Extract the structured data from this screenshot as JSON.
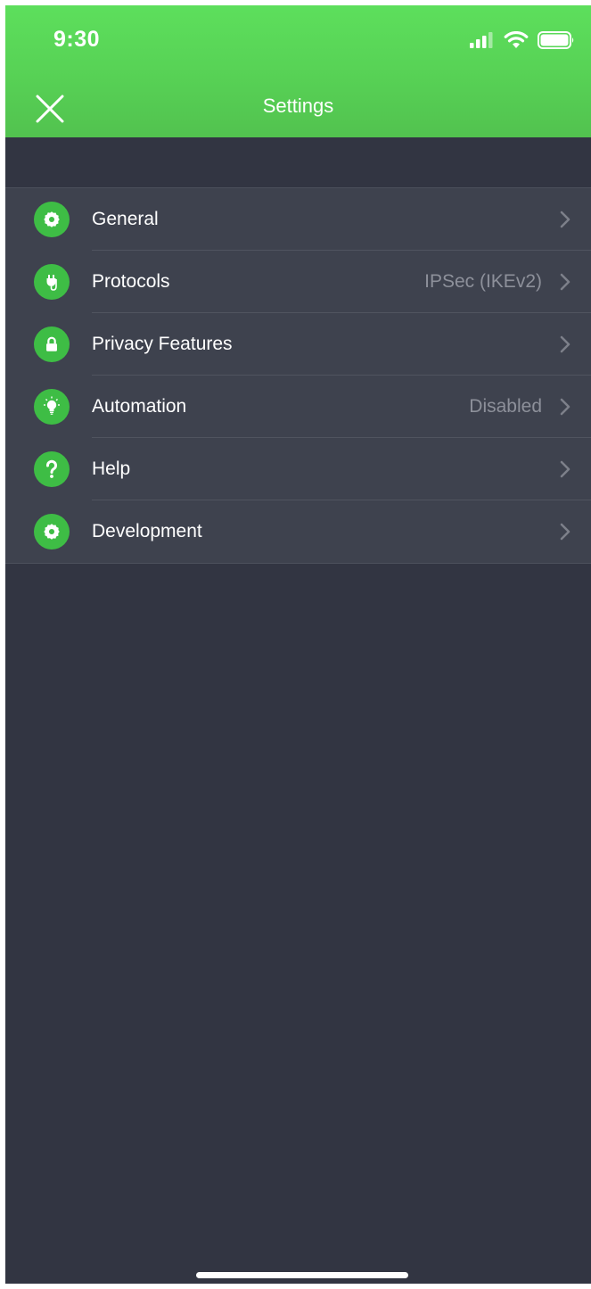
{
  "status_bar": {
    "time": "9:30"
  },
  "nav": {
    "title": "Settings",
    "close_icon": "close-icon"
  },
  "colors": {
    "header_green": "#57d155",
    "icon_green": "#3ebd45",
    "background": "#323542",
    "row_background": "#3e424e",
    "secondary_text": "#8d909a"
  },
  "settings": {
    "items": [
      {
        "label": "General",
        "value": "",
        "icon": "gear-icon"
      },
      {
        "label": "Protocols",
        "value": "IPSec (IKEv2)",
        "icon": "plug-icon"
      },
      {
        "label": "Privacy Features",
        "value": "",
        "icon": "lock-icon"
      },
      {
        "label": "Automation",
        "value": "Disabled",
        "icon": "lightbulb-icon"
      },
      {
        "label": "Help",
        "value": "",
        "icon": "question-icon"
      },
      {
        "label": "Development",
        "value": "",
        "icon": "gear-icon"
      }
    ]
  }
}
